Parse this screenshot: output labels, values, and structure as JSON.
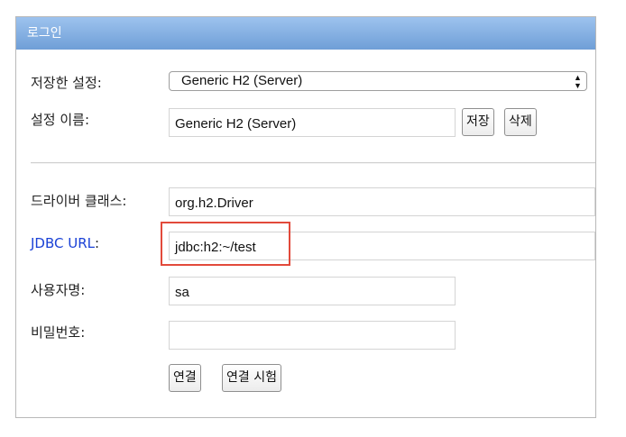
{
  "header": {
    "title": "로그인"
  },
  "saved_settings": {
    "label": "저장한 설정:",
    "selected": "Generic H2 (Server)"
  },
  "setting_name": {
    "label": "설정 이름:",
    "value": "Generic H2 (Server)",
    "save_label": "저장",
    "delete_label": "삭제"
  },
  "driver_class": {
    "label": "드라이버 클래스:",
    "value": "org.h2.Driver"
  },
  "jdbc_url": {
    "label": "JDBC URL",
    "colon": ":",
    "value": "jdbc:h2:~/test"
  },
  "username": {
    "label": "사용자명:",
    "value": "sa"
  },
  "password": {
    "label": "비밀번호:",
    "value": ""
  },
  "actions": {
    "connect_label": "연결",
    "test_connect_label": "연결 시험"
  },
  "colors": {
    "header_top": "#9dc3ee",
    "header_bottom": "#6f9fd7",
    "link": "#1a41d6",
    "highlight": "#e24a3b"
  }
}
